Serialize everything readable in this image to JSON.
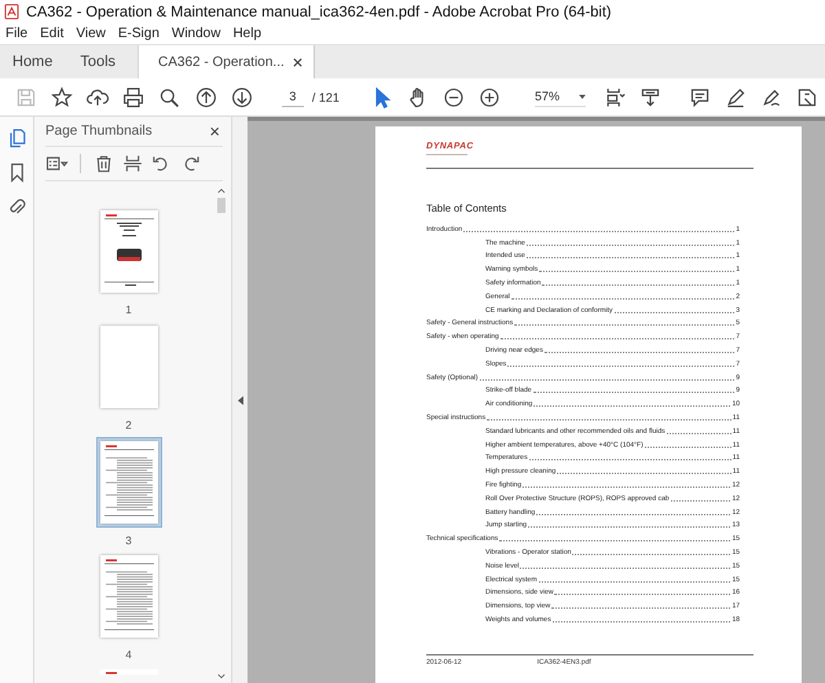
{
  "window": {
    "title": "CA362 - Operation & Maintenance manual_ica362-4en.pdf - Adobe Acrobat Pro (64-bit)"
  },
  "menu": [
    "File",
    "Edit",
    "View",
    "E-Sign",
    "Window",
    "Help"
  ],
  "tabs": [
    {
      "label": "Home",
      "selected": false,
      "closable": false
    },
    {
      "label": "Tools",
      "selected": false,
      "closable": false
    },
    {
      "label": "CA362 - Operation...",
      "selected": true,
      "closable": true
    }
  ],
  "toolbar": {
    "left": [
      {
        "kind": "save",
        "disabled": true
      },
      {
        "kind": "star",
        "disabled": false
      },
      {
        "kind": "upload",
        "disabled": false
      },
      {
        "kind": "print",
        "disabled": false
      },
      {
        "kind": "search",
        "disabled": false
      }
    ],
    "nav": [
      {
        "kind": "up"
      },
      {
        "kind": "down"
      }
    ],
    "page": {
      "value": "3",
      "total": "/ 121"
    },
    "tools": [
      {
        "kind": "pointer",
        "selected": true
      },
      {
        "kind": "hand",
        "selected": false
      },
      {
        "kind": "zoomout",
        "selected": false
      },
      {
        "kind": "zoomin",
        "selected": false
      }
    ],
    "zoom": "57%",
    "right": [
      {
        "kind": "fit"
      },
      {
        "kind": "scroll"
      },
      {
        "kind": "comment"
      },
      {
        "kind": "pen"
      },
      {
        "kind": "sign"
      },
      {
        "kind": "share"
      }
    ]
  },
  "sidebar": {
    "icons": [
      {
        "kind": "pages",
        "selected": true
      },
      {
        "kind": "bookmark",
        "selected": false
      },
      {
        "kind": "clip",
        "selected": false
      }
    ]
  },
  "thumbnails_panel": {
    "title": "Page Thumbnails",
    "close": "×",
    "tools": [
      {
        "kind": "options"
      },
      {
        "kind": "delete"
      },
      {
        "kind": "insert"
      },
      {
        "kind": "undo"
      },
      {
        "kind": "redo"
      }
    ],
    "pages": [
      {
        "label": "1",
        "kind": "cover",
        "selected": false
      },
      {
        "label": "2",
        "kind": "blank",
        "selected": false
      },
      {
        "label": "3",
        "kind": "toc",
        "selected": true
      },
      {
        "label": "4",
        "kind": "toc",
        "selected": false
      }
    ]
  },
  "document": {
    "logo": "DYNAPAC",
    "title": "Table of Contents",
    "toc": [
      {
        "title": "Introduction",
        "page": "1",
        "children": [
          {
            "title": "The machine",
            "page": "1"
          },
          {
            "title": "Intended use",
            "page": "1"
          },
          {
            "title": "Warning symbols",
            "page": "1"
          },
          {
            "title": "Safety information",
            "page": "1"
          },
          {
            "title": "General",
            "page": "2"
          },
          {
            "title": "CE marking and Declaration of conformity",
            "page": "3"
          }
        ]
      },
      {
        "title": "Safety - General instructions",
        "page": "5"
      },
      {
        "title": "Safety - when operating",
        "page": "7",
        "children": [
          {
            "title": "Driving near edges",
            "page": "7"
          },
          {
            "title": "Slopes",
            "page": "7"
          }
        ]
      },
      {
        "title": "Safety (Optional)",
        "page": "9",
        "children": [
          {
            "title": "Strike-off blade",
            "page": "9"
          },
          {
            "title": "Air conditioning",
            "page": "10"
          }
        ]
      },
      {
        "title": "Special instructions",
        "page": "11",
        "children": [
          {
            "title": "Standard lubricants and other recommended oils and fluids",
            "page": "11"
          },
          {
            "title": "Higher ambient temperatures, above +40°C (104°F)",
            "page": "11"
          },
          {
            "title": "Temperatures",
            "page": "11"
          },
          {
            "title": "High pressure cleaning",
            "page": "11"
          },
          {
            "title": "Fire fighting",
            "page": "12"
          },
          {
            "title": "Roll Over Protective Structure (ROPS), ROPS approved cab",
            "page": "12"
          },
          {
            "title": "Battery handling",
            "page": "12"
          },
          {
            "title": "Jump starting",
            "page": "13"
          }
        ]
      },
      {
        "title": "Technical specifications",
        "page": "15",
        "children": [
          {
            "title": "Vibrations - Operator station",
            "page": "15"
          },
          {
            "title": "Noise level",
            "page": "15"
          },
          {
            "title": "Electrical system",
            "page": "15"
          },
          {
            "title": "Dimensions, side view",
            "page": "16"
          },
          {
            "title": "Dimensions, top view",
            "page": "17"
          },
          {
            "title": "Weights and volumes",
            "page": "18"
          }
        ]
      }
    ],
    "footer": {
      "date": "2012-06-12",
      "file": "ICA362-4EN3.pdf"
    }
  }
}
